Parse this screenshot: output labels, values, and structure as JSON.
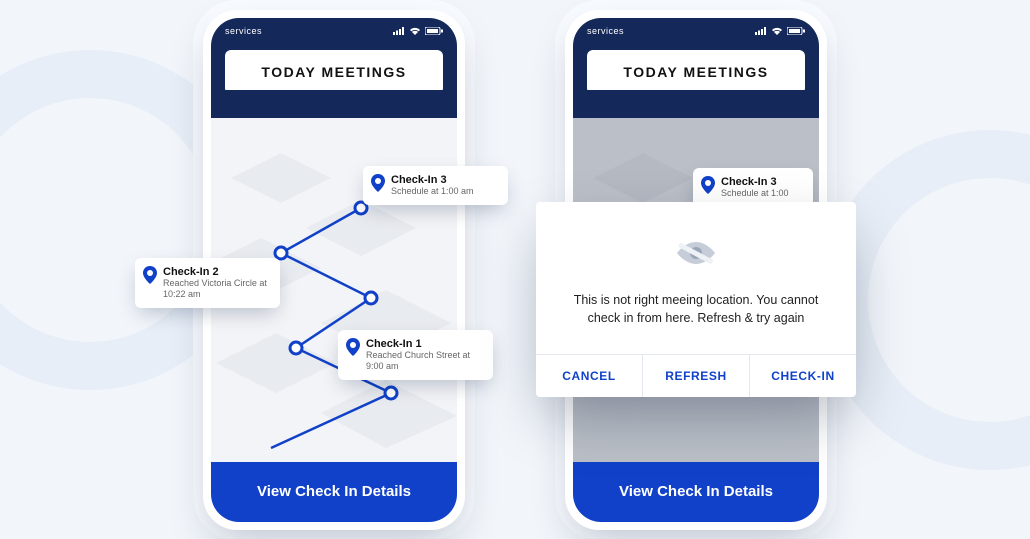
{
  "status": {
    "label": "services"
  },
  "header": {
    "title": "TODAY MEETINGS"
  },
  "checkins": [
    {
      "title": "Check-In 3",
      "subtitle": "Schedule at 1:00 am"
    },
    {
      "title": "Check-In 2",
      "subtitle": "Reached Victoria Circle at 10:22 am"
    },
    {
      "title": "Check-In 1",
      "subtitle": "Reached Church Street at 9:00 am"
    }
  ],
  "cta": {
    "label": "View Check In Details"
  },
  "dialog": {
    "message": "This is not right meeing location. You cannot check in from here. Refresh & try again",
    "actions": {
      "cancel": "CANCEL",
      "refresh": "REFRESH",
      "checkin": "CHECK-IN"
    }
  },
  "colors": {
    "brand_dark": "#14295a",
    "brand_blue": "#1141c9"
  }
}
